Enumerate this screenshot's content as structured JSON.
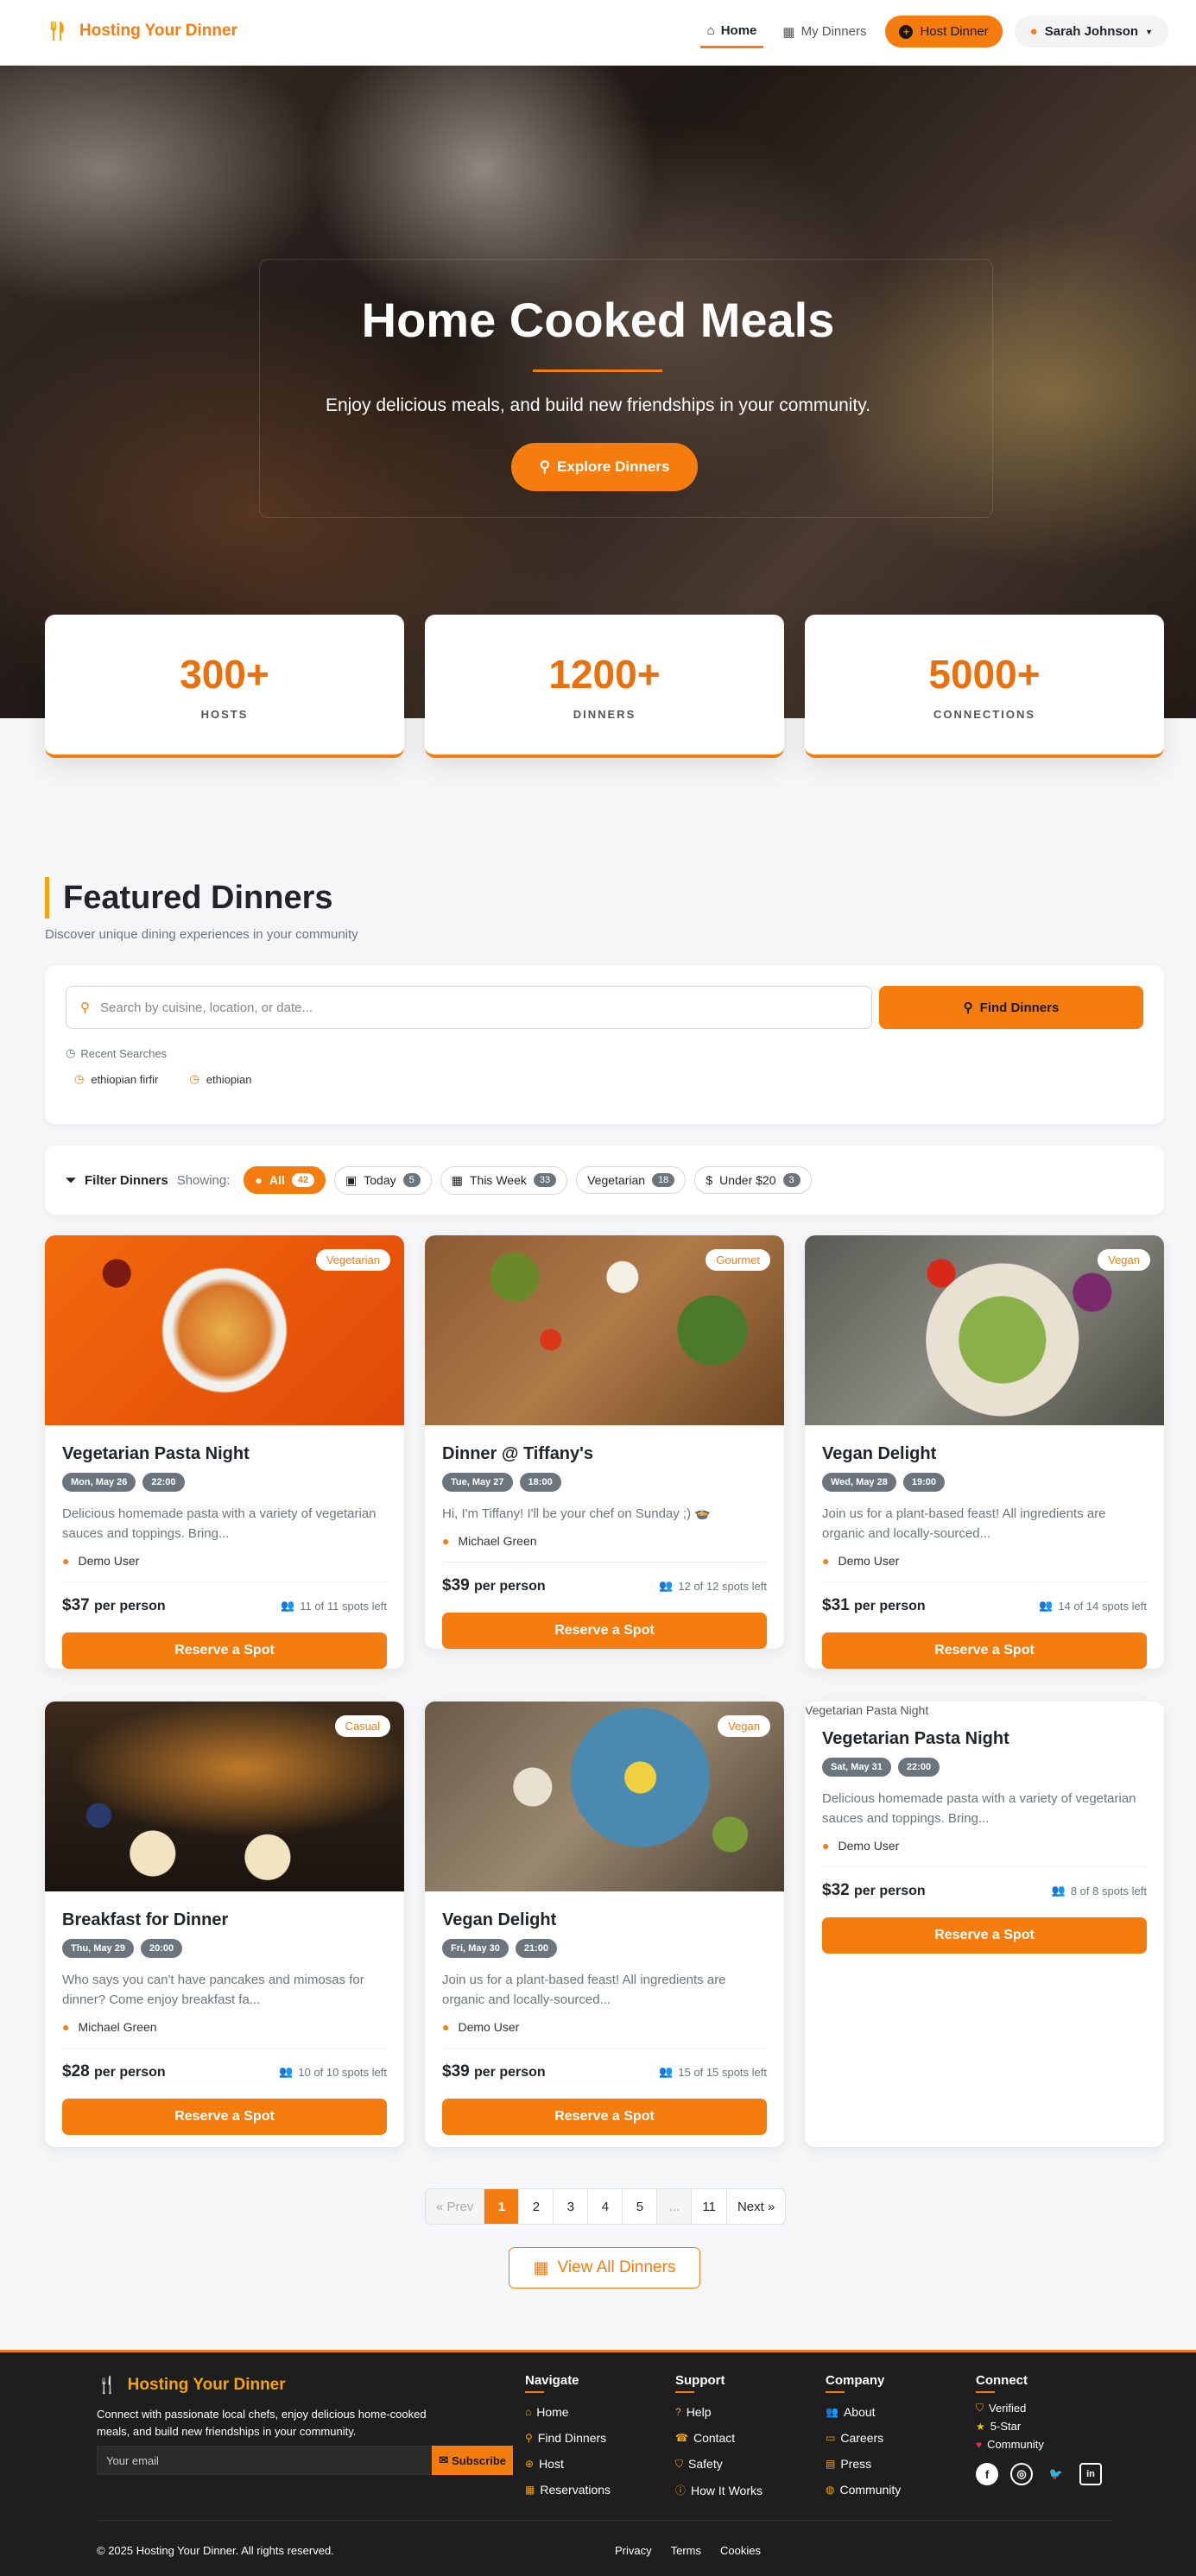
{
  "nav": {
    "brand": "Hosting Your Dinner",
    "home": "Home",
    "my_dinners": "My Dinners",
    "host_dinner": "Host Dinner",
    "user": "Sarah Johnson"
  },
  "hero": {
    "title": "Home Cooked Meals",
    "subtitle": "Enjoy delicious meals, and build new friendships in your community.",
    "cta": "Explore Dinners"
  },
  "stats": [
    {
      "value": "300+",
      "label": "HOSTS"
    },
    {
      "value": "1200+",
      "label": "DINNERS"
    },
    {
      "value": "5000+",
      "label": "CONNECTIONS"
    }
  ],
  "featured": {
    "title": "Featured Dinners",
    "subtitle": "Discover unique dining experiences in your community"
  },
  "search": {
    "placeholder": "Search by cuisine, location, or date...",
    "button": "Find Dinners",
    "recent_label": "Recent Searches",
    "recent": [
      "ethiopian firfir",
      "ethiopian"
    ]
  },
  "filters": {
    "title": "Filter Dinners",
    "showing": "Showing:",
    "chips": [
      {
        "label": "All",
        "count": "42"
      },
      {
        "label": "Today",
        "count": "5"
      },
      {
        "label": "This Week",
        "count": "33"
      },
      {
        "label": "Vegetarian",
        "count": "18"
      },
      {
        "label": "Under $20",
        "count": "3"
      }
    ]
  },
  "cards": [
    {
      "tag": "Vegetarian",
      "title": "Vegetarian Pasta Night",
      "date": "Mon, May 26",
      "time": "22:00",
      "desc": "Delicious homemade pasta with a variety of vegetarian sauces and toppings. Bring...",
      "host": "Demo User",
      "price": "$37",
      "per": "per person",
      "spots": "11 of 11 spots left",
      "reserve": "Reserve a Spot"
    },
    {
      "tag": "Gourmet",
      "title": "Dinner @ Tiffany's",
      "date": "Tue, May 27",
      "time": "18:00",
      "desc": "Hi, I'm Tiffany! I'll be your chef on Sunday ;) 🍲",
      "host": "Michael Green",
      "price": "$39",
      "per": "per person",
      "spots": "12 of 12 spots left",
      "reserve": "Reserve a Spot"
    },
    {
      "tag": "Vegan",
      "title": "Vegan Delight",
      "date": "Wed, May 28",
      "time": "19:00",
      "desc": "Join us for a plant-based feast! All ingredients are organic and locally-sourced...",
      "host": "Demo User",
      "price": "$31",
      "per": "per person",
      "spots": "14 of 14 spots left",
      "reserve": "Reserve a Spot"
    },
    {
      "tag": "Casual",
      "title": "Breakfast for Dinner",
      "date": "Thu, May 29",
      "time": "20:00",
      "desc": "Who says you can't have pancakes and mimosas for dinner? Come enjoy breakfast fa...",
      "host": "Michael Green",
      "price": "$28",
      "per": "per person",
      "spots": "10 of 10 spots left",
      "reserve": "Reserve a Spot"
    },
    {
      "tag": "Vegan",
      "title": "Vegan Delight",
      "date": "Fri, May 30",
      "time": "21:00",
      "desc": "Join us for a plant-based feast! All ingredients are organic and locally-sourced...",
      "host": "Demo User",
      "price": "$39",
      "per": "per person",
      "spots": "15 of 15 spots left",
      "reserve": "Reserve a Spot"
    },
    {
      "alt": "Vegetarian Pasta Night",
      "title": "Vegetarian Pasta Night",
      "date": "Sat, May 31",
      "time": "22:00",
      "desc": "Delicious homemade pasta with a variety of vegetarian sauces and toppings. Bring...",
      "host": "Demo User",
      "price": "$32",
      "per": "per person",
      "spots": "8 of 8 spots left",
      "reserve": "Reserve a Spot"
    }
  ],
  "pagination": {
    "prev": "« Prev",
    "pages": [
      "1",
      "2",
      "3",
      "4",
      "5",
      "...",
      "11"
    ],
    "next": "Next »"
  },
  "view_all": "View All Dinners",
  "footer": {
    "brand": "Hosting Your Dinner",
    "desc": "Connect with passionate local chefs, enjoy delicious home-cooked meals, and build new friendships in your community.",
    "email_placeholder": "Your email",
    "subscribe": "Subscribe",
    "navigate": {
      "title": "Navigate",
      "items": [
        "Home",
        "Find Dinners",
        "Host",
        "Reservations"
      ]
    },
    "support": {
      "title": "Support",
      "items": [
        "Help",
        "Contact",
        "Safety",
        "How It Works"
      ]
    },
    "company": {
      "title": "Company",
      "items": [
        "About",
        "Careers",
        "Press",
        "Community"
      ]
    },
    "connect": {
      "title": "Connect",
      "items": [
        "Verified",
        "5-Star",
        "Community"
      ]
    },
    "copyright": "© 2025 Hosting Your Dinner. All rights reserved.",
    "links": [
      "Privacy",
      "Terms",
      "Cookies"
    ]
  },
  "colors": {
    "accent": "#f57c0f",
    "dark": "#1e1e1e"
  }
}
